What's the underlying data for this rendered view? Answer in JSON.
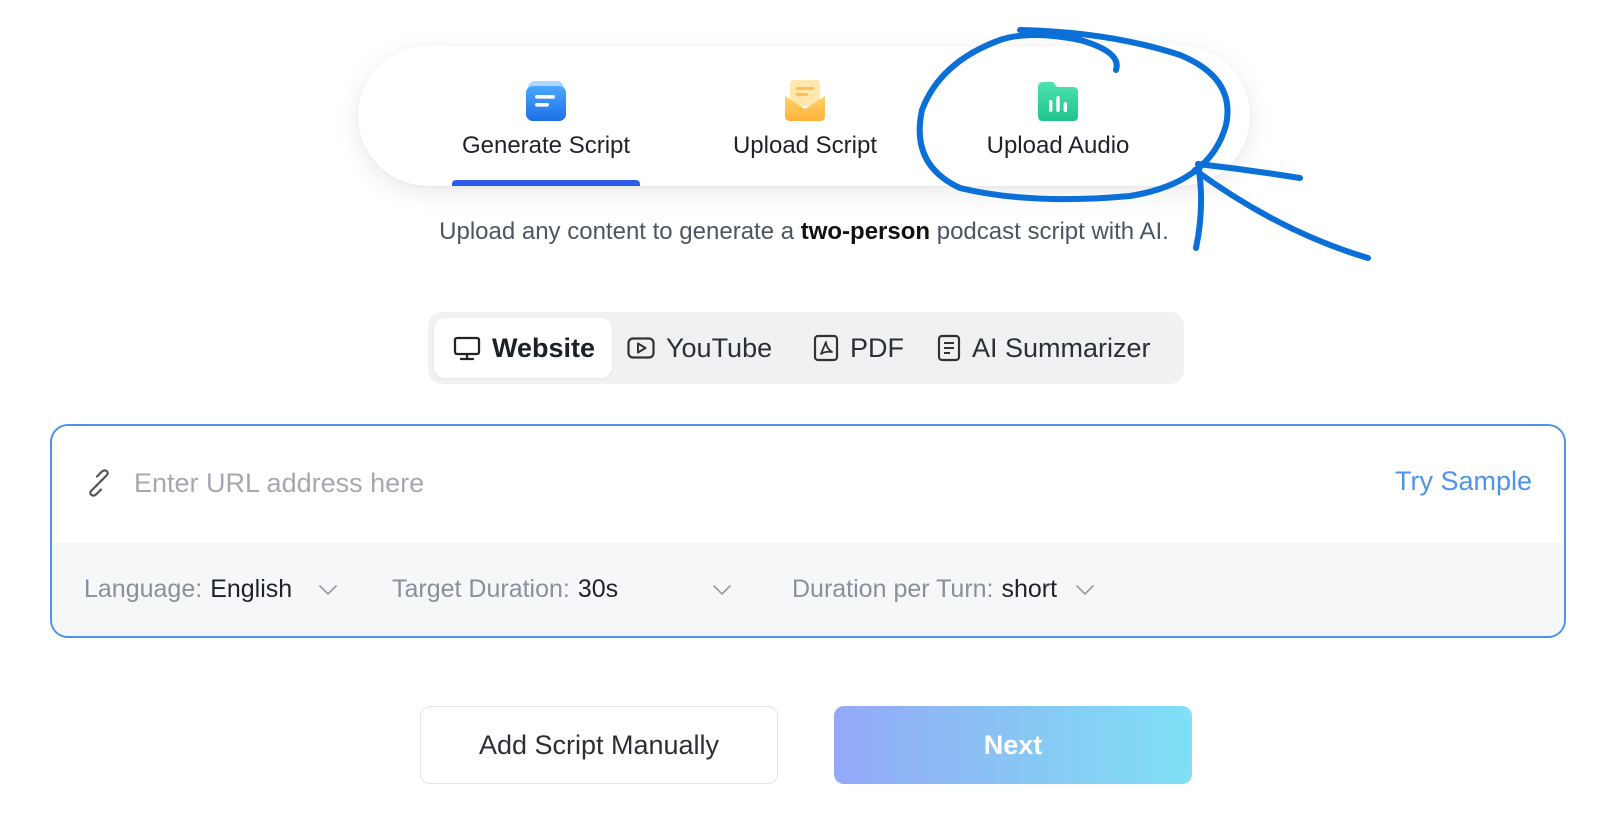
{
  "mode_tabs": {
    "items": [
      {
        "label": "Generate Script",
        "icon": "document-icon",
        "active": true
      },
      {
        "label": "Upload Script",
        "icon": "envelope-icon",
        "active": false
      },
      {
        "label": "Upload Audio",
        "icon": "audio-folder-icon",
        "active": false
      }
    ]
  },
  "tagline": {
    "prefix": "Upload any content to generate a ",
    "emphasis": "two-person",
    "suffix": " podcast script with AI."
  },
  "source_tabs": {
    "items": [
      {
        "label": "Website",
        "icon": "monitor-icon",
        "active": true
      },
      {
        "label": "YouTube",
        "icon": "play-icon",
        "active": false
      },
      {
        "label": "PDF",
        "icon": "pdf-icon",
        "active": false
      },
      {
        "label": "AI Summarizer",
        "icon": "summary-doc-icon",
        "active": false
      }
    ]
  },
  "url_input": {
    "value": "",
    "placeholder": "Enter URL address here",
    "try_sample": "Try Sample"
  },
  "options": {
    "language": {
      "label": "Language:",
      "value": "English"
    },
    "target_duration": {
      "label": "Target Duration:",
      "value": "30s"
    },
    "duration_per_turn": {
      "label": "Duration per Turn:",
      "value": "short"
    }
  },
  "buttons": {
    "add_manual": "Add Script Manually",
    "next": "Next"
  },
  "colors": {
    "accent_blue": "#2f5bea",
    "focus_border": "#4f93e8",
    "annotation_stroke": "#0a6fd6",
    "next_gradient_start": "#94a8f8",
    "next_gradient_end": "#7fe0f7"
  }
}
